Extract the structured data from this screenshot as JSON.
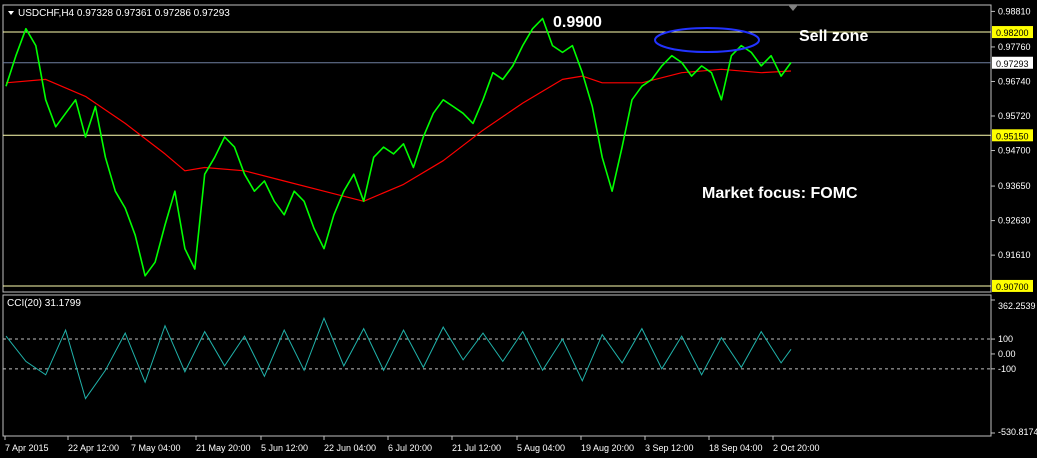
{
  "header": {
    "symbol_line": "USDCHF,H4  0.97328 0.97361 0.97286 0.97293"
  },
  "annotations": {
    "peak_label": "0.9900",
    "sell_zone": "Sell zone",
    "market_focus": "Market focus: FOMC"
  },
  "indicator": {
    "label": "CCI(20) 31.1799",
    "axis_labels": [
      "362.2539",
      "100",
      "0.00",
      "-100",
      "-530.8174"
    ]
  },
  "colors": {
    "background": "#000000",
    "price": "#00ff00",
    "moving_average": "#ff0000",
    "cci": "#20b2aa",
    "level_line": "#ffffb0",
    "level_badge": "#ffff00",
    "current_price_badge": "#ffffff",
    "ellipse": "#2233ff",
    "axis": "#c0c0c0"
  },
  "chart_data": [
    {
      "type": "line",
      "title": "USDCHF,H4",
      "x_tick_labels": [
        "7 Apr 2015",
        "22 Apr 12:00",
        "7 May 04:00",
        "21 May 20:00",
        "5 Jun 12:00",
        "22 Jun 04:00",
        "6 Jul 20:00",
        "21 Jul 12:00",
        "5 Aug 04:00",
        "19 Aug 20:00",
        "3 Sep 12:00",
        "18 Sep 04:00",
        "2 Oct 20:00"
      ],
      "y_tick_labels": [
        "0.98810",
        "0.97760",
        "0.96740",
        "0.95720",
        "0.94700",
        "0.93650",
        "0.92630",
        "0.91610"
      ],
      "ylim": [
        0.9058,
        0.9894
      ],
      "grid": false,
      "level_lines": [
        {
          "value": 0.982,
          "label": "0.98200"
        },
        {
          "value": 0.9515,
          "label": "0.95150"
        },
        {
          "value": 0.907,
          "label": "0.90700"
        }
      ],
      "current_price": {
        "value": 0.97293,
        "label": "0.97293"
      },
      "series": [
        {
          "style": "price",
          "x": [
            0,
            10,
            20,
            30,
            40,
            50,
            60,
            70,
            80,
            90,
            100,
            110,
            120,
            130,
            140,
            150,
            160,
            170,
            180,
            190,
            200,
            210,
            220,
            230,
            240,
            250,
            260,
            270,
            280,
            290,
            300,
            310,
            320,
            330,
            340,
            350,
            360,
            370,
            380,
            390,
            400,
            410,
            420,
            430,
            440,
            450,
            460,
            470,
            480,
            490,
            500,
            510,
            520,
            530,
            540,
            550,
            560,
            570,
            580,
            590,
            600,
            610,
            620,
            630,
            640,
            650,
            660,
            670,
            680,
            690,
            700,
            710,
            720,
            730,
            740,
            750,
            760,
            770,
            780,
            790
          ],
          "values": [
            0.966,
            0.975,
            0.983,
            0.978,
            0.962,
            0.954,
            0.958,
            0.962,
            0.951,
            0.96,
            0.945,
            0.935,
            0.93,
            0.922,
            0.91,
            0.914,
            0.925,
            0.935,
            0.918,
            0.912,
            0.94,
            0.945,
            0.951,
            0.948,
            0.94,
            0.935,
            0.938,
            0.932,
            0.928,
            0.935,
            0.932,
            0.924,
            0.918,
            0.928,
            0.935,
            0.94,
            0.932,
            0.945,
            0.948,
            0.946,
            0.949,
            0.942,
            0.951,
            0.958,
            0.962,
            0.96,
            0.958,
            0.955,
            0.962,
            0.97,
            0.968,
            0.972,
            0.978,
            0.983,
            0.986,
            0.978,
            0.976,
            0.978,
            0.97,
            0.96,
            0.945,
            0.935,
            0.948,
            0.962,
            0.966,
            0.968,
            0.972,
            0.975,
            0.973,
            0.969,
            0.972,
            0.97,
            0.962,
            0.975,
            0.978,
            0.976,
            0.972,
            0.975,
            0.969,
            0.973
          ]
        },
        {
          "style": "moving_average",
          "x": [
            0,
            40,
            80,
            120,
            160,
            180,
            200,
            240,
            280,
            320,
            360,
            400,
            440,
            480,
            520,
            560,
            580,
            600,
            640,
            680,
            720,
            760,
            790
          ],
          "values": [
            0.967,
            0.968,
            0.963,
            0.955,
            0.946,
            0.941,
            0.942,
            0.941,
            0.938,
            0.935,
            0.932,
            0.937,
            0.944,
            0.953,
            0.961,
            0.968,
            0.969,
            0.967,
            0.967,
            0.97,
            0.971,
            0.97,
            0.9705
          ]
        }
      ]
    },
    {
      "type": "line",
      "title": "CCI(20) 31.1799",
      "ylim": [
        -530.8174,
        362.2539
      ],
      "reference_lines": [
        100,
        -100
      ],
      "series": [
        {
          "style": "cci",
          "x": [
            0,
            20,
            40,
            60,
            80,
            100,
            120,
            140,
            160,
            180,
            200,
            220,
            240,
            260,
            280,
            300,
            320,
            340,
            360,
            380,
            400,
            420,
            440,
            460,
            480,
            500,
            520,
            540,
            560,
            580,
            600,
            620,
            640,
            660,
            680,
            700,
            720,
            740,
            760,
            780,
            790
          ],
          "values": [
            120,
            -50,
            -140,
            160,
            -300,
            -110,
            140,
            -190,
            190,
            -120,
            150,
            -80,
            120,
            -150,
            160,
            -110,
            240,
            -80,
            170,
            -110,
            160,
            -90,
            180,
            -40,
            140,
            -50,
            150,
            -110,
            100,
            -180,
            130,
            -60,
            170,
            -100,
            120,
            -140,
            110,
            -90,
            150,
            -60,
            31.1799
          ]
        }
      ]
    }
  ]
}
